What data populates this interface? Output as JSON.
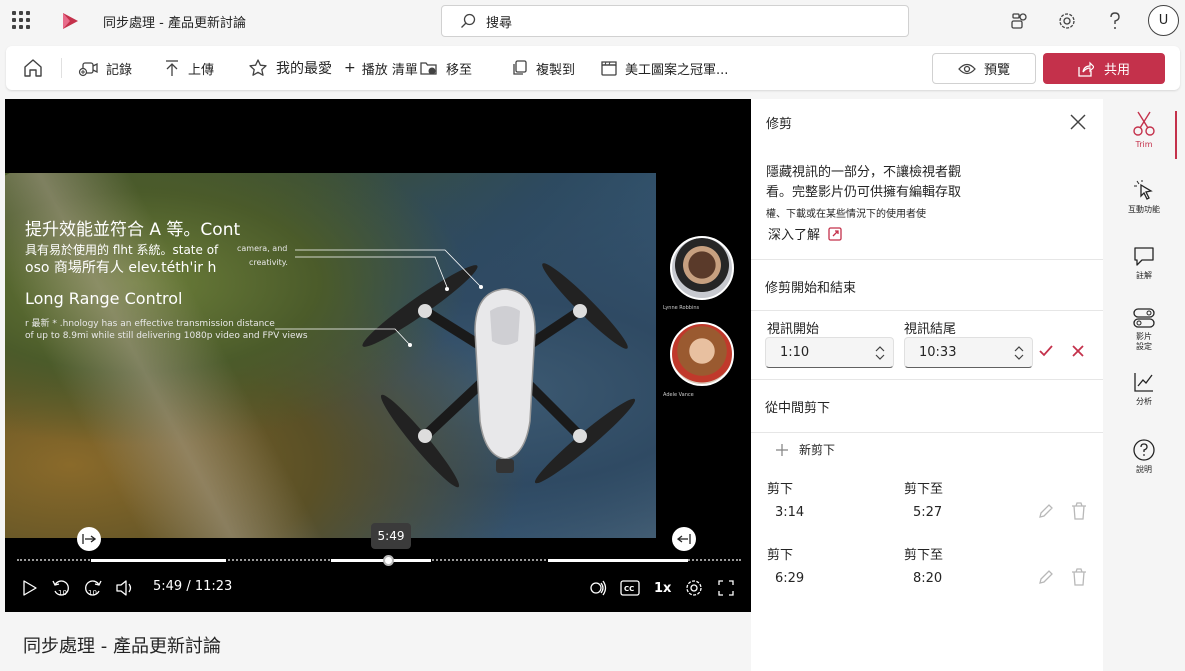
{
  "app": {
    "doc_title": "同步處理 - 產品更新討論",
    "search_placeholder": "搜尋",
    "user_initial": "U",
    "accent_color": "#c4314b"
  },
  "toolbar": {
    "record": "記錄",
    "upload": "上傳",
    "favorites": "我的最愛",
    "playlist": "播放 清單",
    "move_to": "移至",
    "copy_to": "複製到",
    "album": "美工圖案之冠軍...",
    "preview": "預覽",
    "share": "共用"
  },
  "video": {
    "overlay_title": "提升效能並符合 A 等。Cont",
    "overlay_line1": "具有易於使用的 flht 系統。state of",
    "overlay_line2": "oso 商場所有人 elev.téth'ir h",
    "overlay_small1": "camera, and",
    "overlay_small2": "creativity.",
    "feature_title": "Long Range Control",
    "feature_line1": "r 最新 * .hnology has an effective transmission distance",
    "feature_line2": "of up to 8.9mi while still delivering 1080p video and FPV views",
    "person1_name": "Lynne Robbins",
    "person2_name": "Adele Vance",
    "tooltip_time": "5:49",
    "time_display": "5:49 / 11:23",
    "speed": "1x",
    "progress_fraction": 0.513,
    "trim_start_fraction": 0.1,
    "trim_end_fraction": 0.921
  },
  "caption": "同步處理 - 產品更新討論",
  "panel": {
    "title": "修剪",
    "desc": "隱藏視訊的一部分，不讓檢視者觀看。完整影片仍可供擁有編輯存取",
    "desc2": "權、下載或在某些情況下的使用者使",
    "learn_more": "深入了解",
    "section_trim": "修剪開始和結束",
    "start_label": "視訊開始",
    "end_label": "視訊結尾",
    "start_value": "1:10",
    "end_value": "10:33",
    "section_cut": "從中間剪下",
    "new_cut": "新剪下",
    "cuts": [
      {
        "from_label": "剪下",
        "to_label": "剪下至",
        "from": "3:14",
        "to": "5:27"
      },
      {
        "from_label": "剪下",
        "to_label": "剪下至",
        "from": "6:29",
        "to": "8:20"
      }
    ]
  },
  "rail": {
    "trim": "Trim",
    "interactive": "互動功能",
    "comments": "註解",
    "video_settings": "影片設定",
    "analytics": "分析",
    "help": "說明"
  }
}
